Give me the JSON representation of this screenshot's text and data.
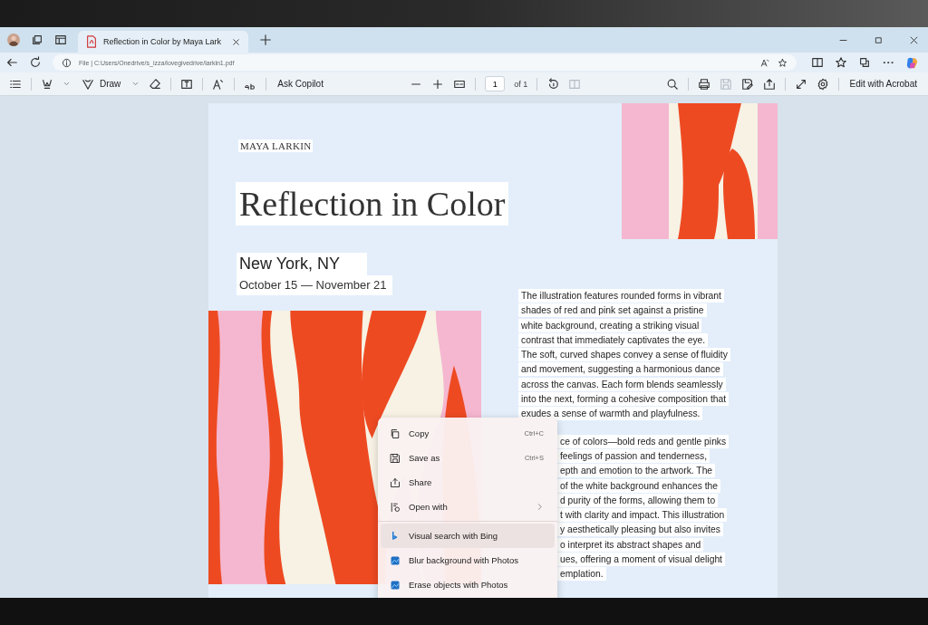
{
  "browser": {
    "tab_title": "Reflection in Color by Maya Lark",
    "address": "File | C:Users/Onedrive/s_izza/lovegivedrive/larkin1.pdf"
  },
  "pdf_toolbar": {
    "draw_label": "Draw",
    "ask_label": "Ask Copilot",
    "page_value": "1",
    "page_count": "of 1",
    "edit_label": "Edit with Acrobat",
    "view_tools": [
      {
        "disabled": false
      },
      {
        "disabled": true
      }
    ],
    "file_tools": [
      {
        "disabled": false
      },
      {
        "disabled": false
      },
      {
        "disabled": true
      },
      {
        "disabled": false
      },
      {
        "disabled": false
      }
    ]
  },
  "document": {
    "author": "MAYA LARKIN",
    "title": "Reflection in Color",
    "location": "New York, NY",
    "dates": "October 15 — November 21",
    "paragraphs": [
      {
        "lines": [
          "The illustration features rounded forms in vibrant",
          "shades of red and pink set against a pristine",
          "white background, creating a striking visual",
          "contrast that immediately captivates the eye.",
          "The soft, curved shapes convey a sense of fluidity",
          "and movement, suggesting a harmonious dance",
          "across the canvas. Each form blends seamlessly",
          "into the next, forming a cohesive composition that",
          "exudes a sense of warmth and playfulness."
        ]
      },
      {
        "lines": [
          "ce of colors—bold reds and gentle pinks",
          "feelings of passion and tenderness,",
          "epth and emotion to the artwork. The",
          "of the white background enhances the",
          "d purity of the forms, allowing them to",
          "t with clarity and impact. This illustration",
          "y aesthetically pleasing but also invites",
          "o interpret its abstract shapes and",
          "ues, offering a moment of visual delight",
          "emplation."
        ]
      }
    ]
  },
  "context_menu": {
    "groups": [
      [
        {
          "label": "Copy",
          "shortcut": "Ctrl+C",
          "submenu": false,
          "selected": false
        },
        {
          "label": "Save as",
          "shortcut": "Ctrl+S",
          "submenu": false,
          "selected": false
        },
        {
          "label": "Share",
          "submenu": false,
          "selected": false
        },
        {
          "label": "Open with",
          "submenu": true,
          "selected": false
        }
      ],
      [
        {
          "label": "Visual search with Bing",
          "submenu": false,
          "selected": true
        },
        {
          "label": "Blur background with Photos",
          "submenu": false,
          "selected": false
        },
        {
          "label": "Erase objects with Photos",
          "submenu": false,
          "selected": false
        }
      ]
    ]
  }
}
